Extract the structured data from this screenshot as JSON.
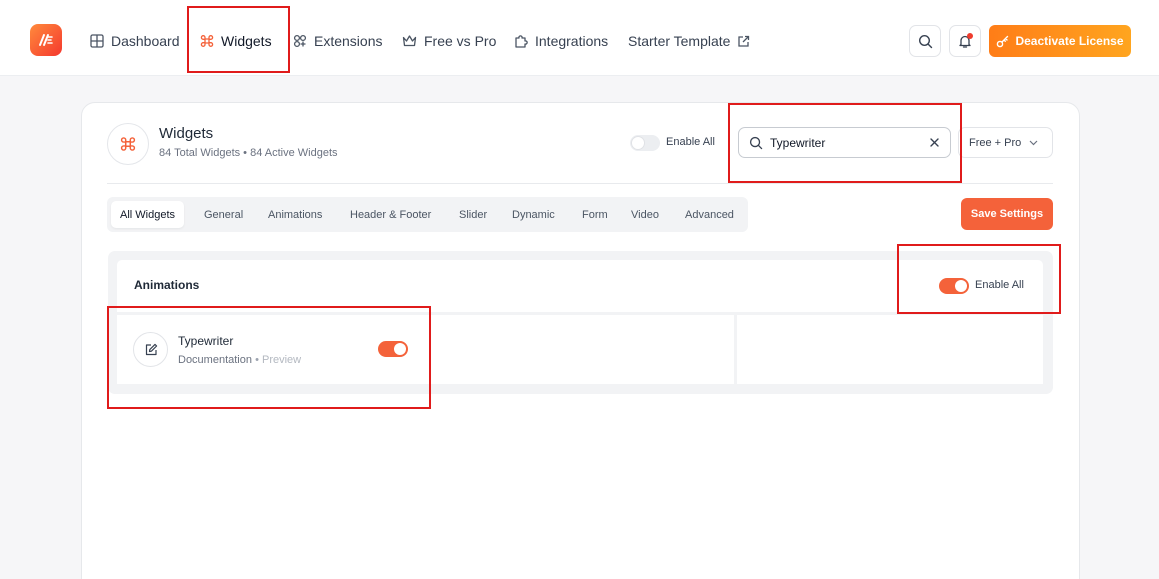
{
  "nav": {
    "items": [
      {
        "label": "Dashboard",
        "icon": "grid-icon"
      },
      {
        "label": "Widgets",
        "icon": "command-icon"
      },
      {
        "label": "Extensions",
        "icon": "extensions-icon"
      },
      {
        "label": "Free vs Pro",
        "icon": "crown-icon"
      },
      {
        "label": "Integrations",
        "icon": "puzzle-icon"
      },
      {
        "label": "Starter Template",
        "icon": "external-link-icon"
      }
    ],
    "license_button": "Deactivate License"
  },
  "header": {
    "title": "Widgets",
    "subtitle": "84 Total Widgets • 84 Active Widgets",
    "enable_all_label": "Enable All",
    "enable_all_on": false,
    "search": {
      "value": "Typewriter",
      "placeholder": "Search"
    },
    "filter_value": "Free + Pro"
  },
  "tabs": [
    "All Widgets",
    "General",
    "Animations",
    "Header & Footer",
    "Slider",
    "Dynamic",
    "Form",
    "Video",
    "Advanced"
  ],
  "active_tab": "All Widgets",
  "save_button": "Save Settings",
  "section": {
    "title": "Animations",
    "enable_all_label": "Enable All",
    "enable_all_on": true,
    "widgets": [
      {
        "name": "Typewriter",
        "doc_link": "Documentation",
        "separator": "•",
        "preview_link": "Preview",
        "enabled": true
      }
    ]
  },
  "colors": {
    "accent": "#f4623a",
    "license_gradient_start": "#ff7d17",
    "license_gradient_end": "#ffa51f",
    "highlight_box": "#e01b1b"
  }
}
